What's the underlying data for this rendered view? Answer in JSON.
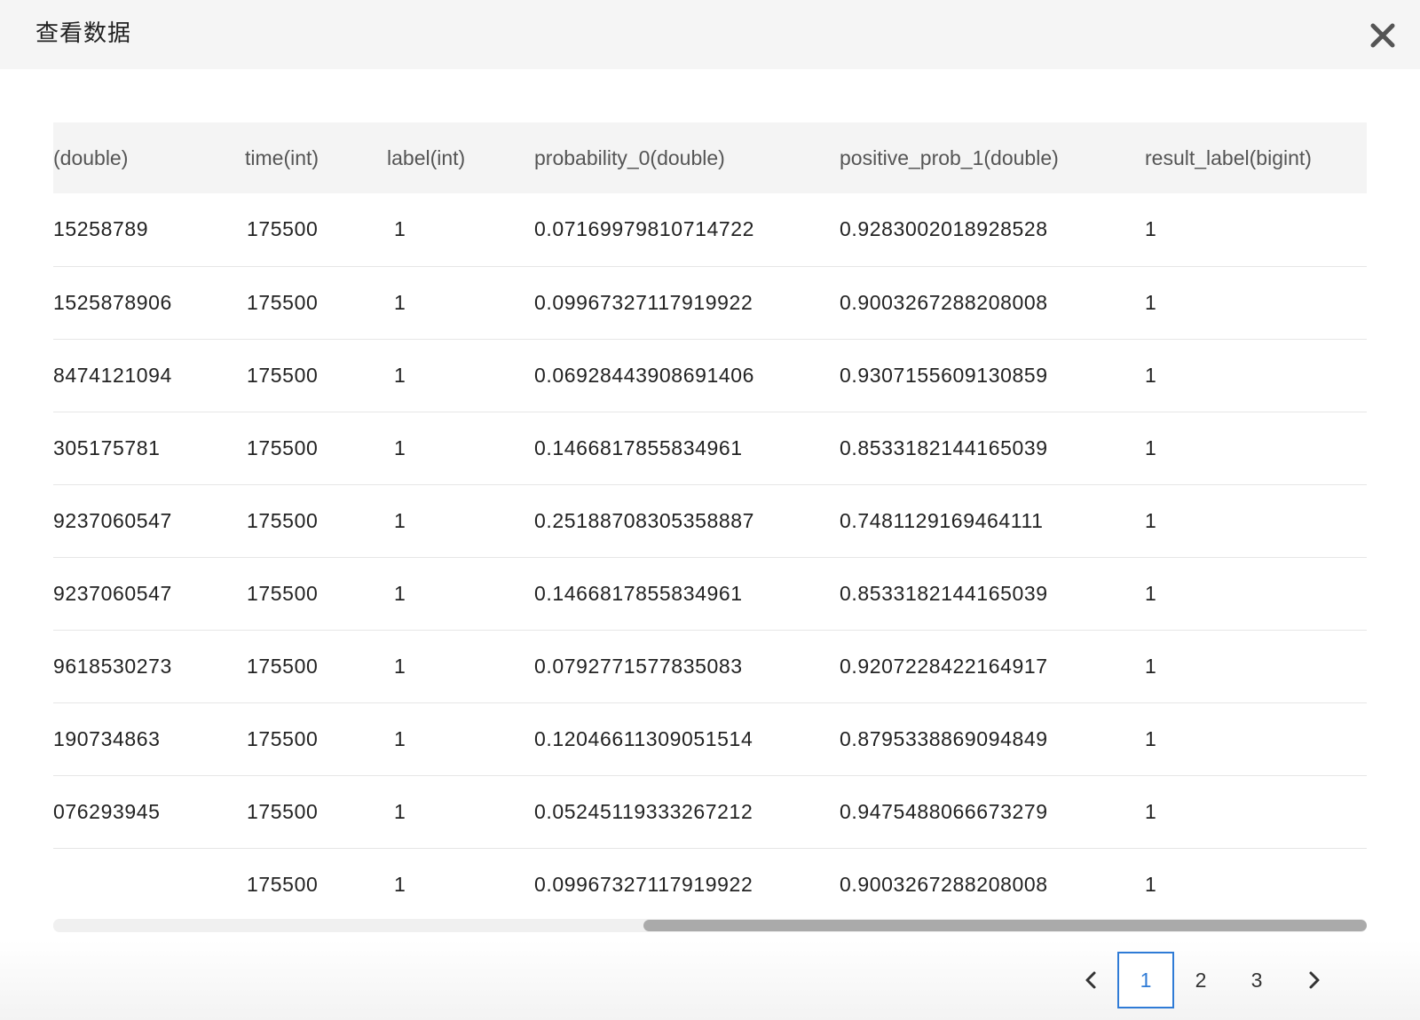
{
  "dialog": {
    "title": "查看数据"
  },
  "table": {
    "columns": [
      "(double)",
      "time(int)",
      "label(int)",
      "probability_0(double)",
      "positive_prob_1(double)",
      "result_label(bigint)"
    ],
    "rows": [
      [
        "15258789",
        "175500",
        "1",
        "0.07169979810714722",
        "0.9283002018928528",
        "1"
      ],
      [
        "1525878906",
        "175500",
        "1",
        "0.09967327117919922",
        "0.9003267288208008",
        "1"
      ],
      [
        "8474121094",
        "175500",
        "1",
        "0.06928443908691406",
        "0.9307155609130859",
        "1"
      ],
      [
        "305175781",
        "175500",
        "1",
        "0.1466817855834961",
        "0.8533182144165039",
        "1"
      ],
      [
        "9237060547",
        "175500",
        "1",
        "0.25188708305358887",
        "0.7481129169464111",
        "1"
      ],
      [
        "9237060547",
        "175500",
        "1",
        "0.1466817855834961",
        "0.8533182144165039",
        "1"
      ],
      [
        "9618530273",
        "175500",
        "1",
        "0.0792771577835083",
        "0.9207228422164917",
        "1"
      ],
      [
        "190734863",
        "175500",
        "1",
        "0.12046611309051514",
        "0.8795338869094849",
        "1"
      ],
      [
        "076293945",
        "175500",
        "1",
        "0.05245119333267212",
        "0.9475488066673279",
        "1"
      ],
      [
        "",
        "175500",
        "1",
        "0.09967327117919922",
        "0.9003267288208008",
        "1"
      ]
    ]
  },
  "pagination": {
    "prev_icon": "chevron-left-icon",
    "next_icon": "chevron-right-icon",
    "pages": [
      "1",
      "2",
      "3"
    ],
    "current": "1"
  },
  "colors": {
    "accent": "#2f7bd6",
    "header_bg": "#f5f5f5",
    "table_header_bg": "#f4f4f4",
    "scroll_thumb": "#aaaaaa"
  }
}
